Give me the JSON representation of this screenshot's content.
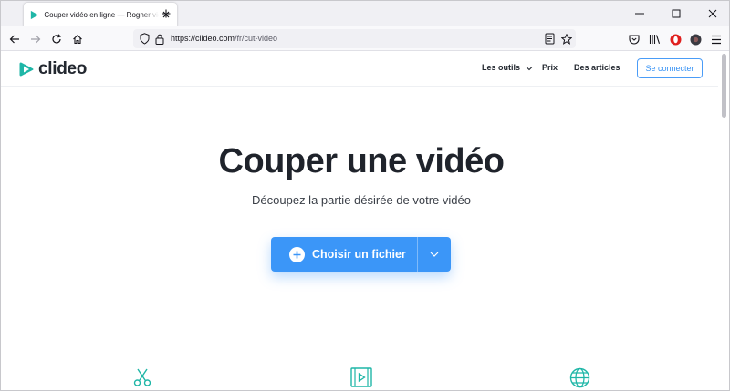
{
  "browser": {
    "tab": {
      "title": "Couper vidéo en ligne — Rogner vidéo"
    },
    "url": {
      "host_prefix": "https://clideo.com",
      "path": "/fr/cut-video"
    }
  },
  "site": {
    "logo_text": "clideo",
    "nav": {
      "tools": "Les outils",
      "pricing": "Prix",
      "articles": "Des articles",
      "login": "Se connecter"
    },
    "hero": {
      "title": "Couper une vidéo",
      "subtitle": "Découpez la partie désirée de votre vidéo",
      "choose_file": "Choisir un fichier"
    }
  },
  "colors": {
    "accent": "#3b96f8",
    "teal_icons": "#1fb6a7",
    "logo_teal": "#1fb6a7"
  },
  "icons": [
    "clideo-favicon",
    "close-icon",
    "plus-icon",
    "back-arrow-icon",
    "forward-arrow-icon",
    "reload-icon",
    "home-icon",
    "shield-icon",
    "lock-icon",
    "reader-view-icon",
    "bookmark-star-icon",
    "pocket-icon",
    "library-icon",
    "opera-icon",
    "account-icon",
    "menu-icon",
    "chevron-down-icon",
    "scissors-icon",
    "video-icon",
    "globe-icon"
  ]
}
